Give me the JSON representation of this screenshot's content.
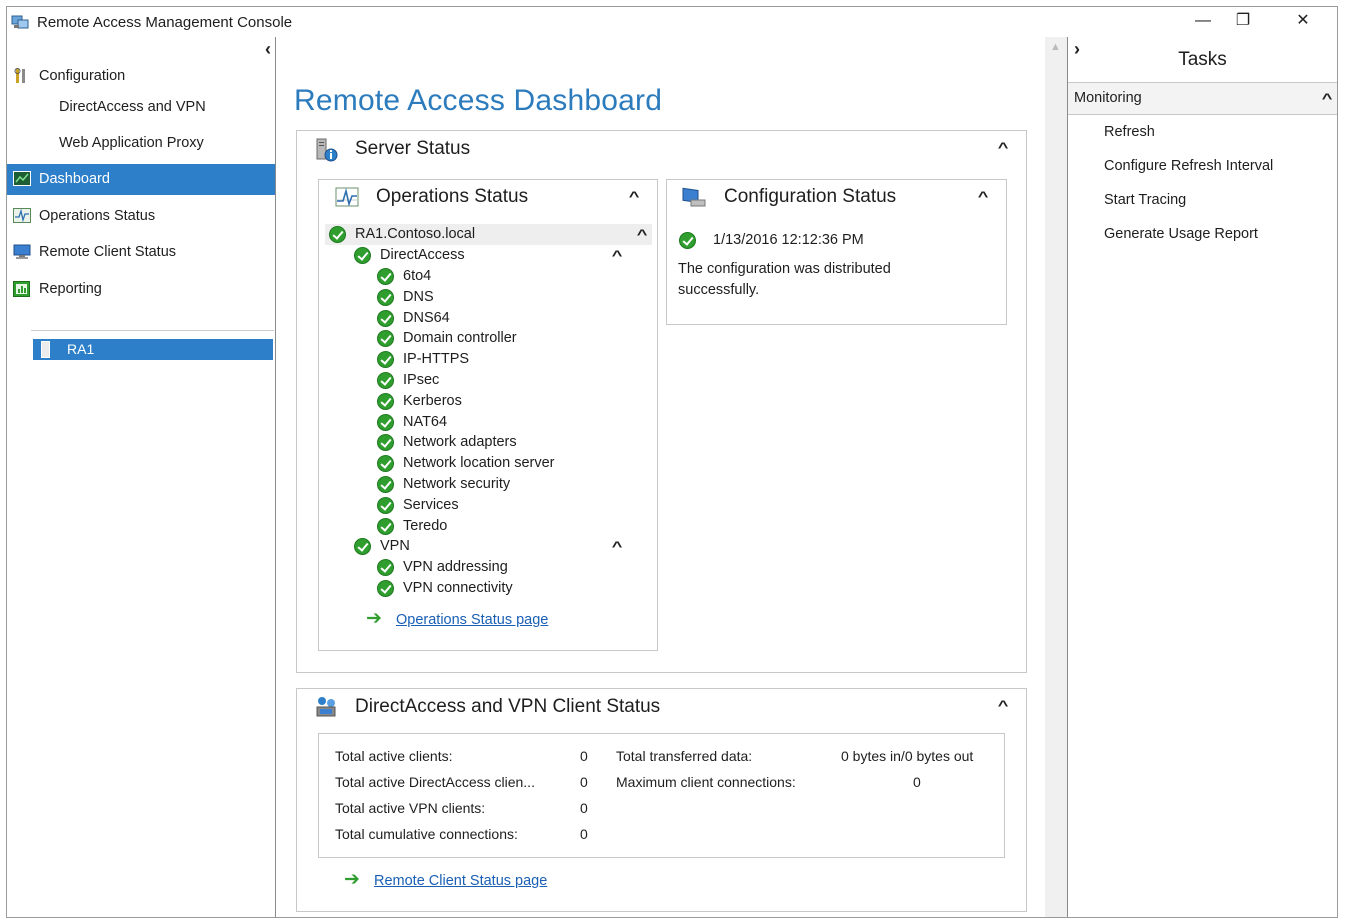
{
  "window": {
    "title": "Remote Access Management Console",
    "minimize_glyph": "—",
    "restore_glyph": "❐",
    "close_glyph": "✕"
  },
  "left_pane": {
    "collapse_glyph": "‹",
    "nav": [
      {
        "label": "Configuration",
        "icon": "configuration-icon"
      },
      {
        "label": "DirectAccess and VPN"
      },
      {
        "label": "Web Application Proxy"
      },
      {
        "label": "Dashboard",
        "icon": "dashboard-icon",
        "selected": true
      },
      {
        "label": "Operations Status",
        "icon": "operations-status-icon"
      },
      {
        "label": "Remote Client Status",
        "icon": "remote-client-icon"
      },
      {
        "label": "Reporting",
        "icon": "reporting-icon"
      }
    ],
    "server": {
      "label": "RA1",
      "icon": "server-icon"
    }
  },
  "dashboard": {
    "title": "Remote Access Dashboard",
    "server_status": {
      "title": "Server Status",
      "icon": "server-info-icon",
      "operations": {
        "title": "Operations Status",
        "icon": "operations-chart-icon",
        "server": "RA1.Contoso.local",
        "directaccess": {
          "label": "DirectAccess",
          "items": [
            "6to4",
            "DNS",
            "DNS64",
            "Domain controller",
            "IP-HTTPS",
            "IPsec",
            "Kerberos",
            "NAT64",
            "Network adapters",
            "Network location server",
            "Network security",
            "Services",
            "Teredo"
          ]
        },
        "vpn": {
          "label": "VPN",
          "items": [
            "VPN addressing",
            "VPN connectivity"
          ]
        },
        "link": "Operations Status page"
      },
      "configuration": {
        "title": "Configuration Status",
        "icon": "computer-icon",
        "timestamp": "1/13/2016 12:12:36 PM",
        "message": "The configuration was distributed successfully."
      }
    },
    "client_status": {
      "title": "DirectAccess and VPN Client Status",
      "icon": "clients-icon",
      "left_stats": [
        {
          "label": "Total active clients:",
          "value": "0"
        },
        {
          "label": "Total active DirectAccess clien...",
          "value": "0"
        },
        {
          "label": "Total active VPN clients:",
          "value": "0"
        },
        {
          "label": "Total cumulative connections:",
          "value": "0"
        }
      ],
      "right_stats": [
        {
          "label": "Total transferred data:",
          "value": "0 bytes in/0 bytes out"
        },
        {
          "label": "Maximum client connections:",
          "value": "0"
        }
      ],
      "link": "Remote Client Status page"
    }
  },
  "tasks": {
    "expand_glyph": "›",
    "title": "Tasks",
    "section": "Monitoring",
    "items": [
      "Refresh",
      "Configure Refresh Interval",
      "Start Tracing",
      "Generate Usage Report"
    ]
  },
  "colors": {
    "accent": "#2d7fc9",
    "title_blue": "#2c7bbd",
    "status_green": "#2f9e2f",
    "link": "#1a5fb4"
  }
}
